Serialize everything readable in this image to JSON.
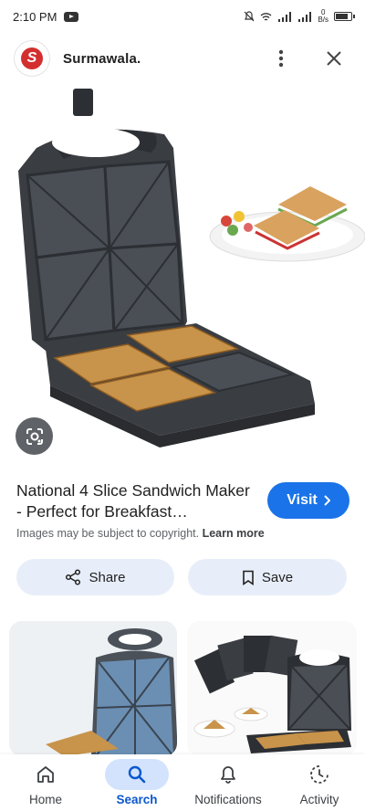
{
  "status_bar": {
    "time": "2:10 PM",
    "net_speed_value": "0",
    "net_speed_unit": "B/s"
  },
  "header": {
    "site_name": "Surmawala.",
    "logo_letter": "S"
  },
  "product": {
    "title": "National 4 Slice Sandwich Maker - Perfect for Breakfast…",
    "visit_label": "Visit",
    "copyright_text": "Images may be subject to copyright.",
    "learn_more": "Learn more"
  },
  "actions": {
    "share_label": "Share",
    "save_label": "Save"
  },
  "bottom_nav": {
    "items": [
      {
        "label": "Home",
        "icon": "home-icon"
      },
      {
        "label": "Search",
        "icon": "search-icon",
        "active": true
      },
      {
        "label": "Notifications",
        "icon": "bell-icon"
      },
      {
        "label": "Activity",
        "icon": "activity-icon"
      }
    ]
  },
  "colors": {
    "accent": "#1a73e8",
    "button_bg": "#e8eef9",
    "nav_active_bg": "#d3e3fd",
    "nav_active_text": "#0b57d0"
  }
}
